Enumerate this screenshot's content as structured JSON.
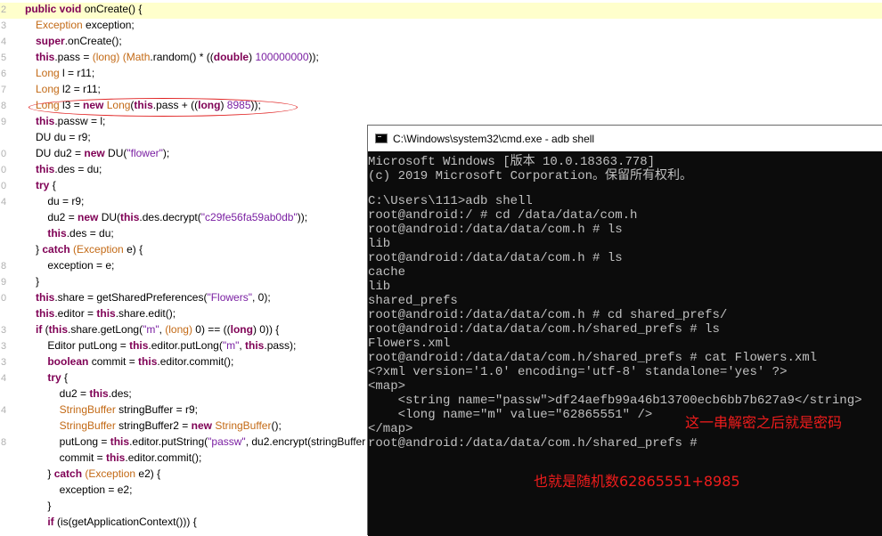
{
  "editor": {
    "gutter": [
      "2",
      "3",
      "4",
      "5",
      "6",
      "7",
      "8",
      "9",
      "",
      "0",
      "0",
      "0",
      "4",
      "",
      "",
      "",
      "8",
      "9",
      "0",
      "",
      "3",
      "3",
      "3",
      "4",
      "",
      "4",
      "",
      "8"
    ],
    "lines": [
      [
        [
          "kw",
          "public "
        ],
        [
          "kw",
          "void "
        ],
        [
          "op",
          "onCreate() {"
        ]
      ],
      [
        [
          "ty",
          "Exception "
        ],
        [
          "op",
          "exception;"
        ]
      ],
      [
        [
          "kw",
          "super"
        ],
        [
          "op",
          ".onCreate();"
        ]
      ],
      [
        [
          "kw",
          "this"
        ],
        [
          "op",
          ".pass = "
        ],
        [
          "ty",
          "(long) "
        ],
        [
          "ty",
          "(Math"
        ],
        [
          "op",
          ".random() * "
        ],
        [
          "op",
          "(("
        ],
        [
          "kw",
          "double"
        ],
        [
          "op",
          ") "
        ],
        [
          "num",
          "100000000"
        ],
        [
          "op",
          "));"
        ]
      ],
      [
        [
          "ty",
          "Long "
        ],
        [
          "op",
          "l = r11;"
        ]
      ],
      [
        [
          "ty",
          "Long "
        ],
        [
          "op",
          "l2 = r11;"
        ]
      ],
      [
        [
          "ty",
          "Long "
        ],
        [
          "op",
          "l3 = "
        ],
        [
          "kw",
          "new "
        ],
        [
          "ty",
          "Long"
        ],
        [
          "op",
          "("
        ],
        [
          "kw",
          "this"
        ],
        [
          "op",
          ".pass + (("
        ],
        [
          "kw",
          "long"
        ],
        [
          "op",
          ") "
        ],
        [
          "num",
          "8985"
        ],
        [
          "op",
          "));"
        ]
      ],
      [
        [
          "kw",
          "this"
        ],
        [
          "op",
          ".passw = l;"
        ]
      ],
      [
        [
          "op",
          "DU du = r9;"
        ]
      ],
      [
        [
          "op",
          "DU du2 = "
        ],
        [
          "kw",
          "new "
        ],
        [
          "op",
          "DU("
        ],
        [
          "str",
          "\"flower\""
        ],
        [
          "op",
          ");"
        ]
      ],
      [
        [
          "kw",
          "this"
        ],
        [
          "op",
          ".des = du;"
        ]
      ],
      [
        [
          "kw",
          "try "
        ],
        [
          "op",
          "{"
        ]
      ],
      [
        [
          "op",
          "    du = r9;"
        ]
      ],
      [
        [
          "op",
          "    du2 = "
        ],
        [
          "kw",
          "new "
        ],
        [
          "op",
          "DU("
        ],
        [
          "kw",
          "this"
        ],
        [
          "op",
          ".des.decrypt("
        ],
        [
          "str",
          "\"c29fe56fa59ab0db\""
        ],
        [
          "op",
          "));"
        ]
      ],
      [
        [
          "op",
          "    "
        ],
        [
          "kw",
          "this"
        ],
        [
          "op",
          ".des = du;"
        ]
      ],
      [
        [
          "op",
          "} "
        ],
        [
          "kw",
          "catch "
        ],
        [
          "ty",
          "(Exception "
        ],
        [
          "op",
          "e) {"
        ]
      ],
      [
        [
          "op",
          "    exception = e;"
        ]
      ],
      [
        [
          "op",
          "}"
        ]
      ],
      [
        [
          "kw",
          "this"
        ],
        [
          "op",
          ".share = getSharedPreferences("
        ],
        [
          "str",
          "\"Flowers\""
        ],
        [
          "op",
          ", 0);"
        ]
      ],
      [
        [
          "kw",
          "this"
        ],
        [
          "op",
          ".editor = "
        ],
        [
          "kw",
          "this"
        ],
        [
          "op",
          ".share.edit();"
        ]
      ],
      [
        [
          "kw",
          "if "
        ],
        [
          "op",
          "("
        ],
        [
          "kw",
          "this"
        ],
        [
          "op",
          ".share.getLong("
        ],
        [
          "str",
          "\"m\""
        ],
        [
          "op",
          ", "
        ],
        [
          "ty",
          "(long) "
        ],
        [
          "op",
          "0) == (("
        ],
        [
          "kw",
          "long"
        ],
        [
          "op",
          ") 0)) {"
        ]
      ],
      [
        [
          "op",
          "    Editor putLong = "
        ],
        [
          "kw",
          "this"
        ],
        [
          "op",
          ".editor.putLong("
        ],
        [
          "str",
          "\"m\""
        ],
        [
          "op",
          ", "
        ],
        [
          "kw",
          "this"
        ],
        [
          "op",
          ".pass);"
        ]
      ],
      [
        [
          "op",
          "    "
        ],
        [
          "kw",
          "boolean "
        ],
        [
          "op",
          "commit = "
        ],
        [
          "kw",
          "this"
        ],
        [
          "op",
          ".editor.commit();"
        ]
      ],
      [
        [
          "op",
          "    "
        ],
        [
          "kw",
          "try "
        ],
        [
          "op",
          "{"
        ]
      ],
      [
        [
          "op",
          "        du2 = "
        ],
        [
          "kw",
          "this"
        ],
        [
          "op",
          ".des;"
        ]
      ],
      [
        [
          "op",
          "        "
        ],
        [
          "ty",
          "StringBuffer "
        ],
        [
          "op",
          "stringBuffer = r9;"
        ]
      ],
      [
        [
          "op",
          "        "
        ],
        [
          "ty",
          "StringBuffer "
        ],
        [
          "op",
          "stringBuffer2 = "
        ],
        [
          "kw",
          "new "
        ],
        [
          "ty",
          "StringBuffer"
        ],
        [
          "op",
          "();"
        ]
      ],
      [
        [
          "op",
          "        putLong = "
        ],
        [
          "kw",
          "this"
        ],
        [
          "op",
          ".editor.putString("
        ],
        [
          "str",
          "\"passw\""
        ],
        [
          "op",
          ", du2.encrypt(stringBuffer"
        ]
      ],
      [
        [
          "op",
          "        commit = "
        ],
        [
          "kw",
          "this"
        ],
        [
          "op",
          ".editor.commit();"
        ]
      ],
      [
        [
          "op",
          "    } "
        ],
        [
          "kw",
          "catch "
        ],
        [
          "ty",
          "(Exception "
        ],
        [
          "op",
          "e2) {"
        ]
      ],
      [
        [
          "op",
          "        exception = e2;"
        ]
      ],
      [
        [
          "op",
          "    }"
        ]
      ],
      [
        [
          "op",
          "    "
        ],
        [
          "kw",
          "if "
        ],
        [
          "op",
          "(is(getApplicationContext())) {"
        ]
      ]
    ]
  },
  "cmd": {
    "title": "C:\\Windows\\system32\\cmd.exe - adb  shell",
    "lines": [
      "Microsoft Windows [版本 10.0.18363.778]",
      "(c) 2019 Microsoft Corporation。保留所有权利。",
      "",
      "C:\\Users\\111>adb shell",
      "root@android:/ # cd /data/data/com.h",
      "root@android:/data/data/com.h # ls",
      "lib",
      "root@android:/data/data/com.h # ls",
      "cache",
      "lib",
      "shared_prefs",
      "root@android:/data/data/com.h # cd shared_prefs/",
      "root@android:/data/data/com.h/shared_prefs # ls",
      "Flowers.xml",
      "root@android:/data/data/com.h/shared_prefs # cat Flowers.xml",
      "<?xml version='1.0' encoding='utf-8' standalone='yes' ?>",
      "<map>",
      "    <string name=\"passw\">df24aefb99a46b13700ecb6bb7b627a9</string>",
      "    <long name=\"m\" value=\"62865551\" />",
      "</map>",
      "root@android:/data/data/com.h/shared_prefs #"
    ],
    "note1": "这一串解密之后就是密码",
    "note2": "也就是随机数62865551+8985"
  },
  "colors": {
    "annotation_red": "#ee1c1c",
    "terminal_bg": "#0c0c0c",
    "terminal_fg": "#c0c0c0"
  }
}
